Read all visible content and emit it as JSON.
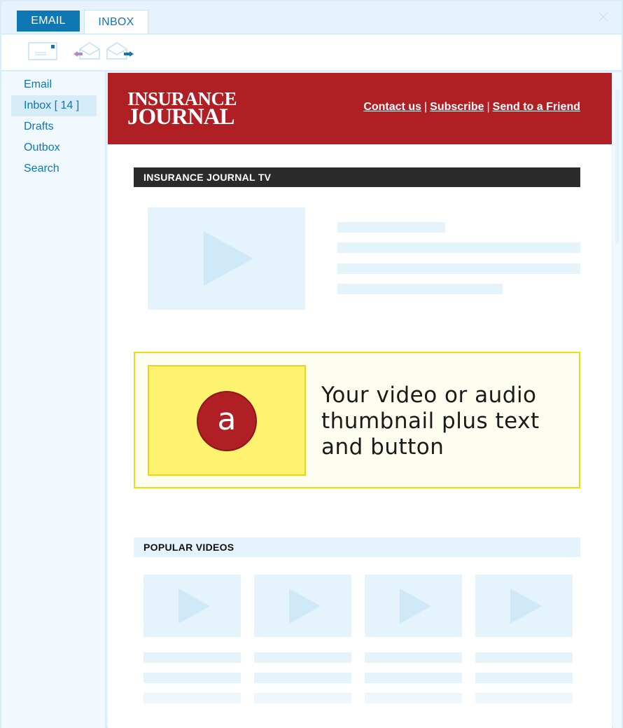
{
  "tabs": [
    {
      "label": "EMAIL",
      "active": false
    },
    {
      "label": "INBOX",
      "active": true
    }
  ],
  "toolbar": {
    "icons": [
      "compose-icon",
      "reply-icon",
      "forward-icon"
    ]
  },
  "sidebar": {
    "items": [
      {
        "label": "Email"
      },
      {
        "label": "Inbox [ 14 ]",
        "active": true
      },
      {
        "label": "Drafts"
      },
      {
        "label": "Outbox"
      },
      {
        "label": "Search"
      }
    ]
  },
  "email": {
    "logo_line1": "INSURANCE",
    "logo_line2": "JOURNAL",
    "links": {
      "contact": "Contact us",
      "separator": "|",
      "subscribe": "Subscribe",
      "send_friend": "Send to a Friend"
    },
    "section_tv": "INSURANCE JOURNAL TV",
    "ad": {
      "badge_letter": "a",
      "text": "Your video or audio thumbnail plus text and button"
    },
    "section_popular": "POPULAR VIDEOS"
  },
  "colors": {
    "brand_red": "#b01f24",
    "accent_blue": "#0e77b4",
    "placeholder": "#e4f3fc",
    "ad_yellow": "#fdf36e"
  }
}
